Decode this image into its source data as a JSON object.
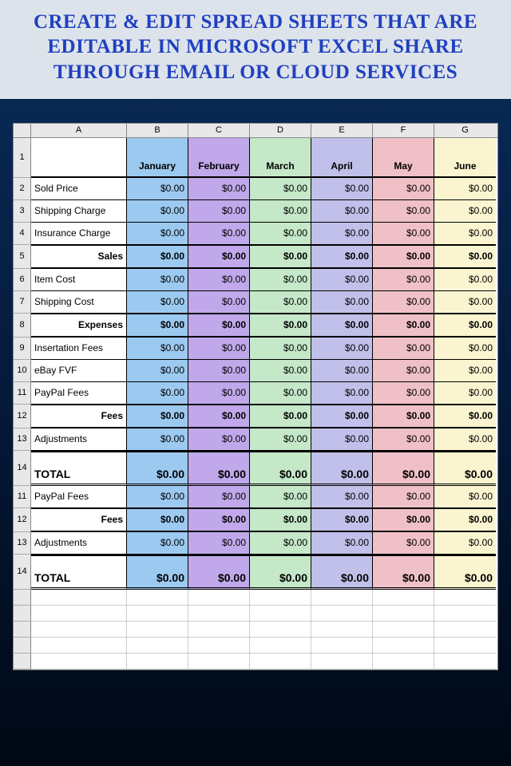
{
  "header_title": "CREATE & EDIT SPREAD SHEETS THAT ARE EDITABLE  IN  MICROSOFT EXCEL  SHARE THROUGH EMAIL OR CLOUD SERVICES",
  "cols": [
    "A",
    "B",
    "C",
    "D",
    "E",
    "F",
    "G"
  ],
  "months": [
    "January",
    "February",
    "March",
    "April",
    "May",
    "June"
  ],
  "rows": [
    {
      "n": "1",
      "label": "",
      "type": "hdr"
    },
    {
      "n": "2",
      "label": "Sold Price",
      "v": [
        "$0.00",
        "$0.00",
        "$0.00",
        "$0.00",
        "$0.00",
        "$0.00"
      ],
      "type": "data"
    },
    {
      "n": "3",
      "label": "Shipping Charge",
      "v": [
        "$0.00",
        "$0.00",
        "$0.00",
        "$0.00",
        "$0.00",
        "$0.00"
      ],
      "type": "data"
    },
    {
      "n": "4",
      "label": "Insurance Charge",
      "v": [
        "$0.00",
        "$0.00",
        "$0.00",
        "$0.00",
        "$0.00",
        "$0.00"
      ],
      "type": "data"
    },
    {
      "n": "5",
      "label": "Sales",
      "v": [
        "$0.00",
        "$0.00",
        "$0.00",
        "$0.00",
        "$0.00",
        "$0.00"
      ],
      "type": "sub"
    },
    {
      "n": "6",
      "label": "Item Cost",
      "v": [
        "$0.00",
        "$0.00",
        "$0.00",
        "$0.00",
        "$0.00",
        "$0.00"
      ],
      "type": "data"
    },
    {
      "n": "7",
      "label": "Shipping Cost",
      "v": [
        "$0.00",
        "$0.00",
        "$0.00",
        "$0.00",
        "$0.00",
        "$0.00"
      ],
      "type": "data"
    },
    {
      "n": "8",
      "label": "Expenses",
      "v": [
        "$0.00",
        "$0.00",
        "$0.00",
        "$0.00",
        "$0.00",
        "$0.00"
      ],
      "type": "sub"
    },
    {
      "n": "9",
      "label": "Insertation Fees",
      "v": [
        "$0.00",
        "$0.00",
        "$0.00",
        "$0.00",
        "$0.00",
        "$0.00"
      ],
      "type": "data"
    },
    {
      "n": "10",
      "label": "eBay FVF",
      "v": [
        "$0.00",
        "$0.00",
        "$0.00",
        "$0.00",
        "$0.00",
        "$0.00"
      ],
      "type": "data"
    },
    {
      "n": "11",
      "label": "PayPal Fees",
      "v": [
        "$0.00",
        "$0.00",
        "$0.00",
        "$0.00",
        "$0.00",
        "$0.00"
      ],
      "type": "data"
    },
    {
      "n": "12",
      "label": "Fees",
      "v": [
        "$0.00",
        "$0.00",
        "$0.00",
        "$0.00",
        "$0.00",
        "$0.00"
      ],
      "type": "sub"
    },
    {
      "n": "13",
      "label": "Adjustments",
      "v": [
        "$0.00",
        "$0.00",
        "$0.00",
        "$0.00",
        "$0.00",
        "$0.00"
      ],
      "type": "data"
    },
    {
      "n": "14",
      "label": "TOTAL",
      "v": [
        "$0.00",
        "$0.00",
        "$0.00",
        "$0.00",
        "$0.00",
        "$0.00"
      ],
      "type": "total"
    },
    {
      "n": "11",
      "label": "PayPal Fees",
      "v": [
        "$0.00",
        "$0.00",
        "$0.00",
        "$0.00",
        "$0.00",
        "$0.00"
      ],
      "type": "data"
    },
    {
      "n": "12",
      "label": "Fees",
      "v": [
        "$0.00",
        "$0.00",
        "$0.00",
        "$0.00",
        "$0.00",
        "$0.00"
      ],
      "type": "sub"
    },
    {
      "n": "13",
      "label": "Adjustments",
      "v": [
        "$0.00",
        "$0.00",
        "$0.00",
        "$0.00",
        "$0.00",
        "$0.00"
      ],
      "type": "data"
    },
    {
      "n": "14",
      "label": "TOTAL",
      "v": [
        "$0.00",
        "$0.00",
        "$0.00",
        "$0.00",
        "$0.00",
        "$0.00"
      ],
      "type": "total"
    }
  ],
  "empty_rows": 5,
  "chart_data": {
    "type": "table",
    "title": "Monthly Sales/Expenses",
    "categories": [
      "January",
      "February",
      "March",
      "April",
      "May",
      "June"
    ],
    "series": [
      {
        "name": "Sold Price",
        "values": [
          0,
          0,
          0,
          0,
          0,
          0
        ]
      },
      {
        "name": "Shipping Charge",
        "values": [
          0,
          0,
          0,
          0,
          0,
          0
        ]
      },
      {
        "name": "Insurance Charge",
        "values": [
          0,
          0,
          0,
          0,
          0,
          0
        ]
      },
      {
        "name": "Sales",
        "values": [
          0,
          0,
          0,
          0,
          0,
          0
        ]
      },
      {
        "name": "Item Cost",
        "values": [
          0,
          0,
          0,
          0,
          0,
          0
        ]
      },
      {
        "name": "Shipping Cost",
        "values": [
          0,
          0,
          0,
          0,
          0,
          0
        ]
      },
      {
        "name": "Expenses",
        "values": [
          0,
          0,
          0,
          0,
          0,
          0
        ]
      },
      {
        "name": "Insertation Fees",
        "values": [
          0,
          0,
          0,
          0,
          0,
          0
        ]
      },
      {
        "name": "eBay FVF",
        "values": [
          0,
          0,
          0,
          0,
          0,
          0
        ]
      },
      {
        "name": "PayPal Fees",
        "values": [
          0,
          0,
          0,
          0,
          0,
          0
        ]
      },
      {
        "name": "Fees",
        "values": [
          0,
          0,
          0,
          0,
          0,
          0
        ]
      },
      {
        "name": "Adjustments",
        "values": [
          0,
          0,
          0,
          0,
          0,
          0
        ]
      },
      {
        "name": "TOTAL",
        "values": [
          0,
          0,
          0,
          0,
          0,
          0
        ]
      }
    ]
  }
}
